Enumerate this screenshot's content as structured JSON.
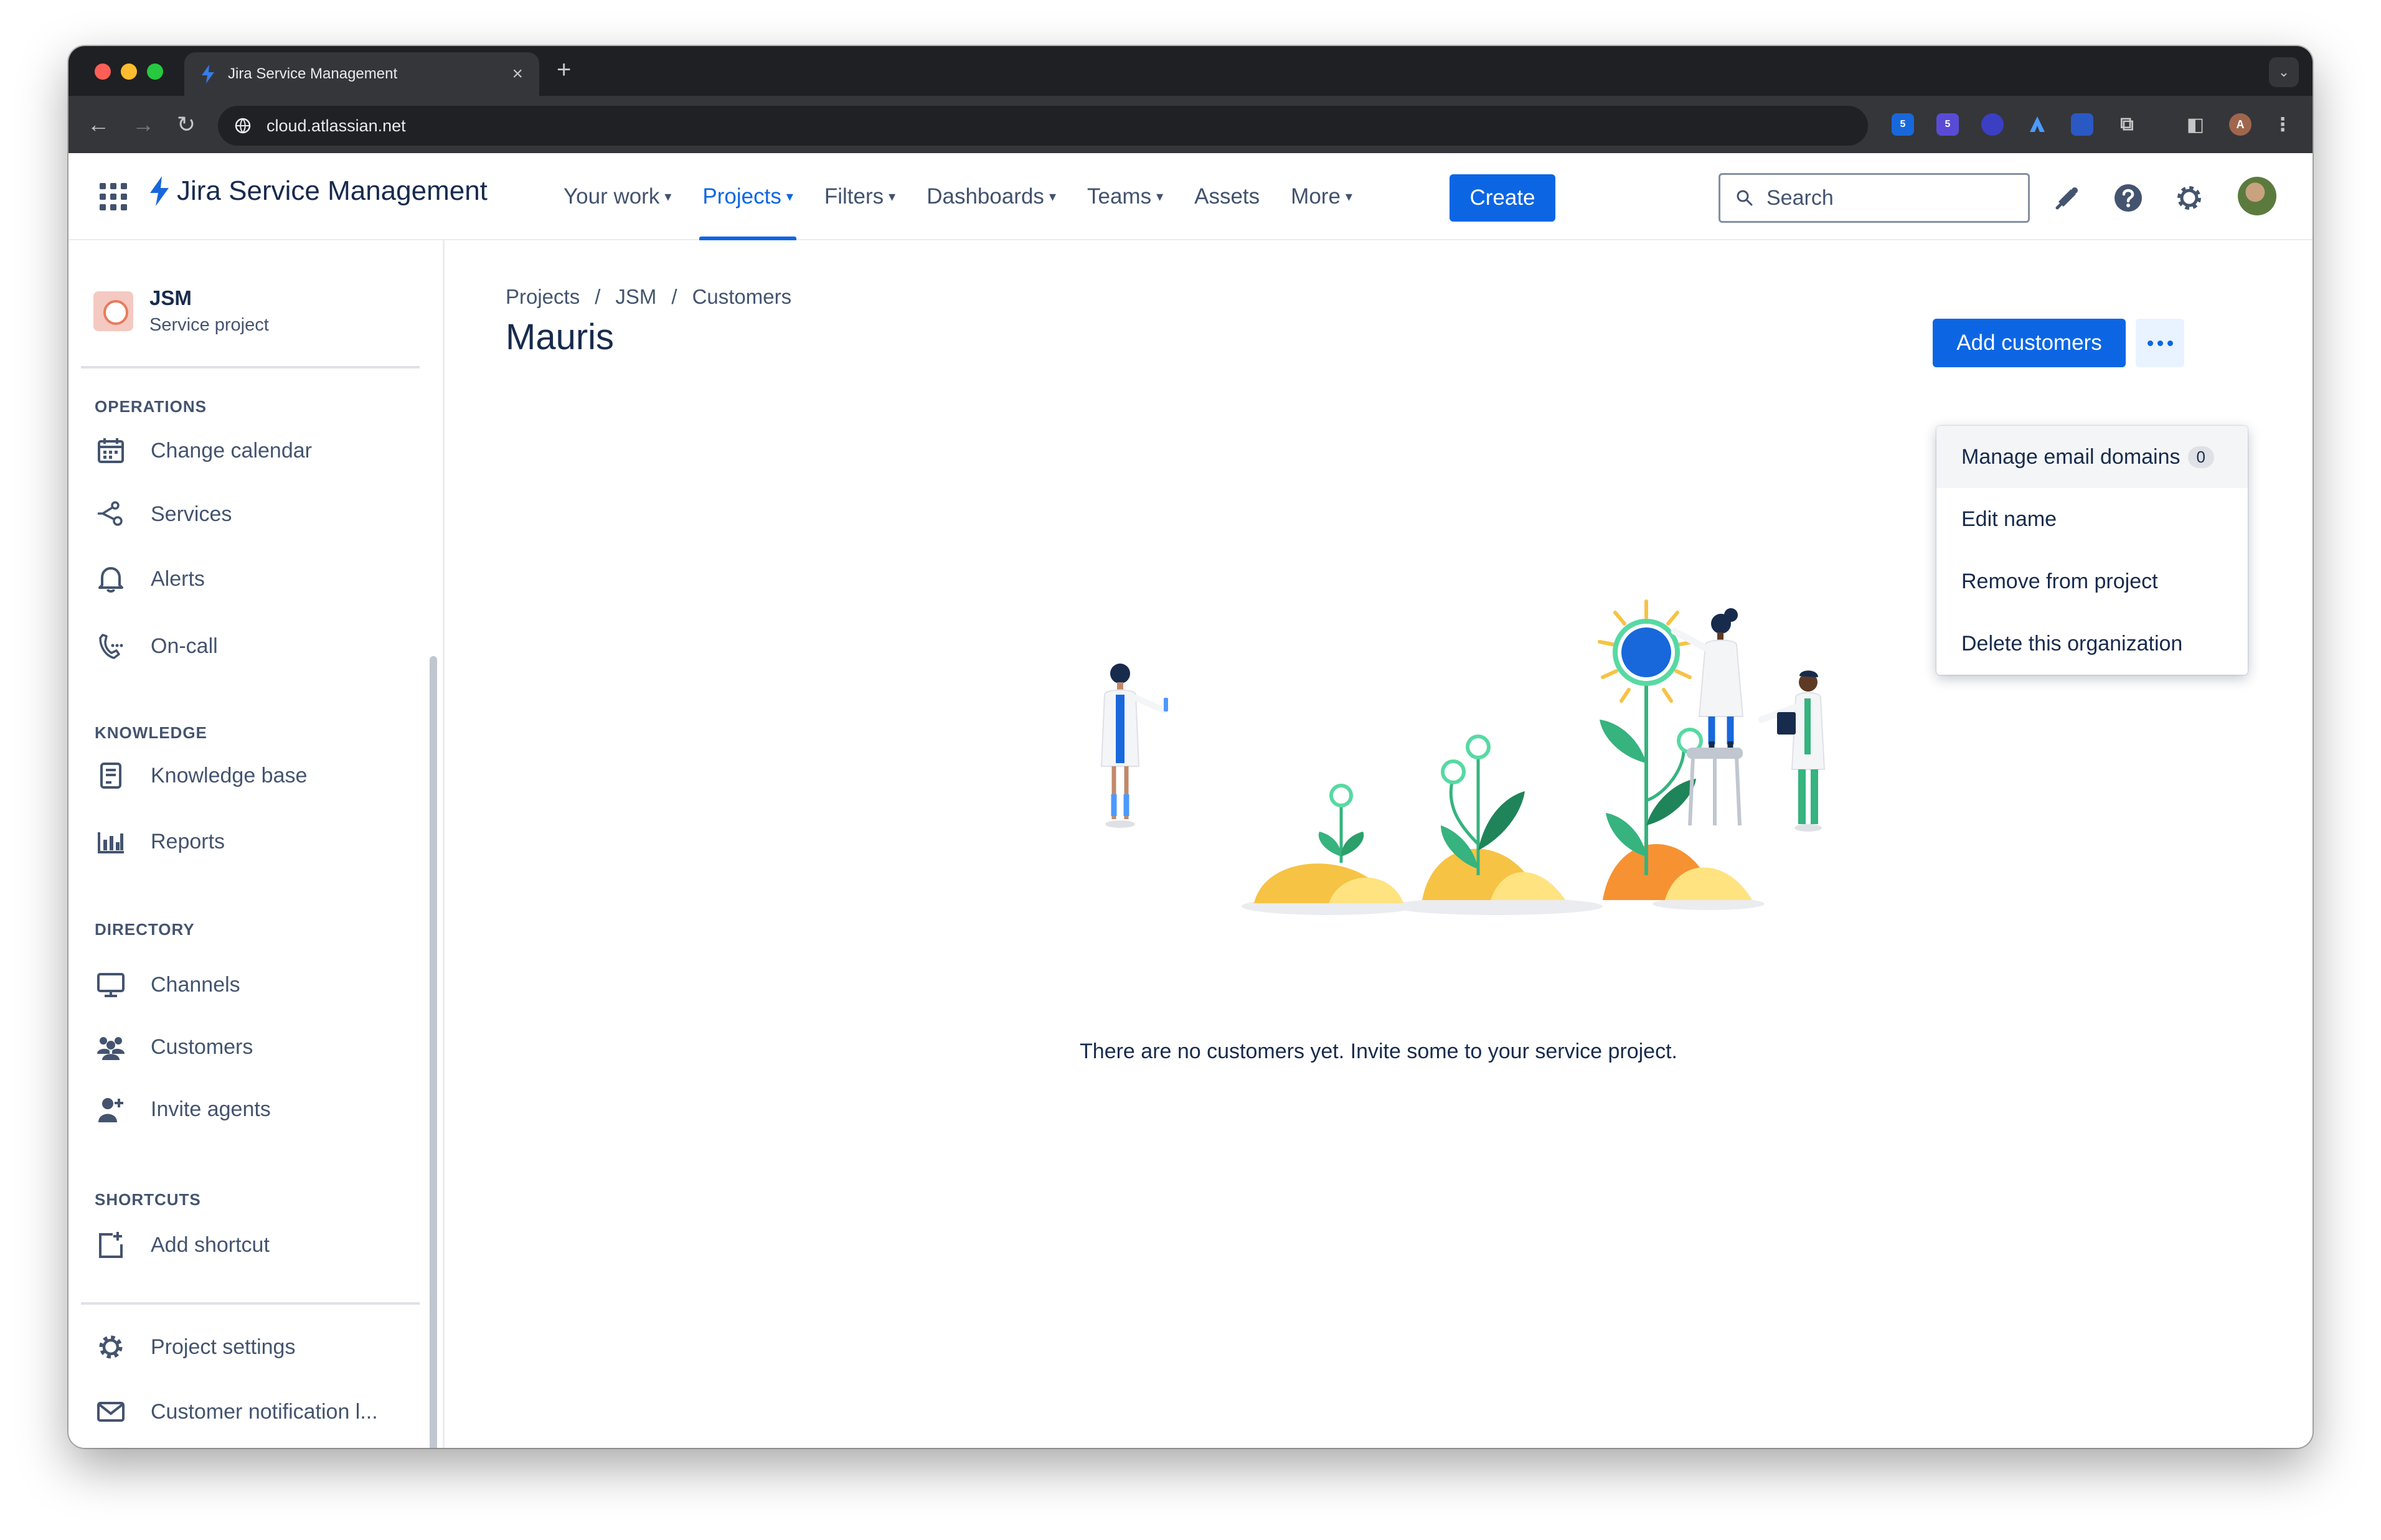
{
  "browser": {
    "tab_title": "Jira Service Management",
    "tab_close": "×",
    "new_tab": "+",
    "url": "cloud.atlassian.net",
    "ext_badge_1": "5",
    "ext_badge_2": "5",
    "profile_initial": "A"
  },
  "topnav": {
    "brand": "Jira Service Management",
    "items": [
      {
        "label": "Your work",
        "chevron": true
      },
      {
        "label": "Projects",
        "chevron": true,
        "active": true
      },
      {
        "label": "Filters",
        "chevron": true
      },
      {
        "label": "Dashboards",
        "chevron": true
      },
      {
        "label": "Teams",
        "chevron": true
      },
      {
        "label": "Assets",
        "chevron": false
      },
      {
        "label": "More",
        "chevron": true
      }
    ],
    "create_label": "Create",
    "search_placeholder": "Search"
  },
  "sidebar": {
    "project_name": "JSM",
    "project_type": "Service project",
    "sections": {
      "operations": "OPERATIONS",
      "knowledge": "KNOWLEDGE",
      "directory": "DIRECTORY",
      "shortcuts": "SHORTCUTS"
    },
    "items": {
      "change_calendar": "Change calendar",
      "services": "Services",
      "alerts": "Alerts",
      "on_call": "On-call",
      "knowledge_base": "Knowledge base",
      "reports": "Reports",
      "channels": "Channels",
      "customers": "Customers",
      "invite_agents": "Invite agents",
      "add_shortcut": "Add shortcut",
      "project_settings": "Project settings",
      "customer_notification": "Customer notification l..."
    }
  },
  "main": {
    "breadcrumb": [
      "Projects",
      "JSM",
      "Customers"
    ],
    "breadcrumb_sep": "/",
    "title": "Mauris",
    "add_customers_label": "Add customers",
    "menu": {
      "manage_email_domains": "Manage email domains",
      "manage_email_domains_count": "0",
      "edit_name": "Edit name",
      "remove_from_project": "Remove from project",
      "delete_organization": "Delete this organization"
    },
    "empty_message": "There are no customers yet. Invite some to your service project."
  },
  "colors": {
    "accent": "#0c66e4",
    "text": "#172b4d",
    "subtle_text": "#44546f"
  }
}
